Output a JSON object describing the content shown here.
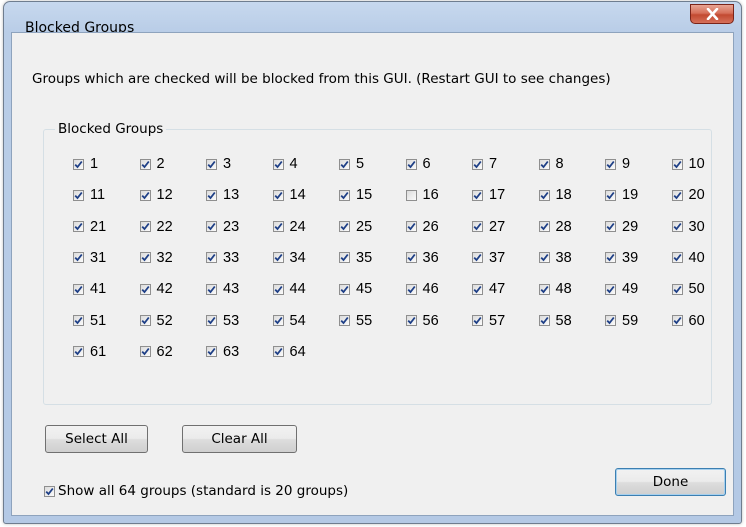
{
  "window": {
    "title": "Blocked Groups",
    "close_symbol": "X"
  },
  "description": "Groups which are checked will be blocked from this GUI.  (Restart GUI to see changes)",
  "groupbox": {
    "label": "Blocked Groups"
  },
  "groups": [
    {
      "label": "1",
      "checked": true
    },
    {
      "label": "2",
      "checked": true
    },
    {
      "label": "3",
      "checked": true
    },
    {
      "label": "4",
      "checked": true
    },
    {
      "label": "5",
      "checked": true
    },
    {
      "label": "6",
      "checked": true
    },
    {
      "label": "7",
      "checked": true
    },
    {
      "label": "8",
      "checked": true
    },
    {
      "label": "9",
      "checked": true
    },
    {
      "label": "10",
      "checked": true
    },
    {
      "label": "11",
      "checked": true
    },
    {
      "label": "12",
      "checked": true
    },
    {
      "label": "13",
      "checked": true
    },
    {
      "label": "14",
      "checked": true
    },
    {
      "label": "15",
      "checked": true
    },
    {
      "label": "16",
      "checked": false
    },
    {
      "label": "17",
      "checked": true
    },
    {
      "label": "18",
      "checked": true
    },
    {
      "label": "19",
      "checked": true
    },
    {
      "label": "20",
      "checked": true
    },
    {
      "label": "21",
      "checked": true
    },
    {
      "label": "22",
      "checked": true
    },
    {
      "label": "23",
      "checked": true
    },
    {
      "label": "24",
      "checked": true
    },
    {
      "label": "25",
      "checked": true
    },
    {
      "label": "26",
      "checked": true
    },
    {
      "label": "27",
      "checked": true
    },
    {
      "label": "28",
      "checked": true
    },
    {
      "label": "29",
      "checked": true
    },
    {
      "label": "30",
      "checked": true
    },
    {
      "label": "31",
      "checked": true
    },
    {
      "label": "32",
      "checked": true
    },
    {
      "label": "33",
      "checked": true
    },
    {
      "label": "34",
      "checked": true
    },
    {
      "label": "35",
      "checked": true
    },
    {
      "label": "36",
      "checked": true
    },
    {
      "label": "37",
      "checked": true
    },
    {
      "label": "38",
      "checked": true
    },
    {
      "label": "39",
      "checked": true
    },
    {
      "label": "40",
      "checked": true
    },
    {
      "label": "41",
      "checked": true
    },
    {
      "label": "42",
      "checked": true
    },
    {
      "label": "43",
      "checked": true
    },
    {
      "label": "44",
      "checked": true
    },
    {
      "label": "45",
      "checked": true
    },
    {
      "label": "46",
      "checked": true
    },
    {
      "label": "47",
      "checked": true
    },
    {
      "label": "48",
      "checked": true
    },
    {
      "label": "49",
      "checked": true
    },
    {
      "label": "50",
      "checked": true
    },
    {
      "label": "51",
      "checked": true
    },
    {
      "label": "52",
      "checked": true
    },
    {
      "label": "53",
      "checked": true
    },
    {
      "label": "54",
      "checked": true
    },
    {
      "label": "55",
      "checked": true
    },
    {
      "label": "56",
      "checked": true
    },
    {
      "label": "57",
      "checked": true
    },
    {
      "label": "58",
      "checked": true
    },
    {
      "label": "59",
      "checked": true
    },
    {
      "label": "60",
      "checked": true
    },
    {
      "label": "61",
      "checked": true
    },
    {
      "label": "62",
      "checked": true
    },
    {
      "label": "63",
      "checked": true
    },
    {
      "label": "64",
      "checked": true
    }
  ],
  "buttons": {
    "select_all": "Select All",
    "clear_all": "Clear All",
    "done": "Done"
  },
  "show_all": {
    "label": "Show all 64 groups (standard is 20 groups)",
    "checked": true
  },
  "colors": {
    "check_mark": "#1e3f86",
    "close_button": "#c94a31",
    "dialog_background": "#f0f0f0"
  }
}
